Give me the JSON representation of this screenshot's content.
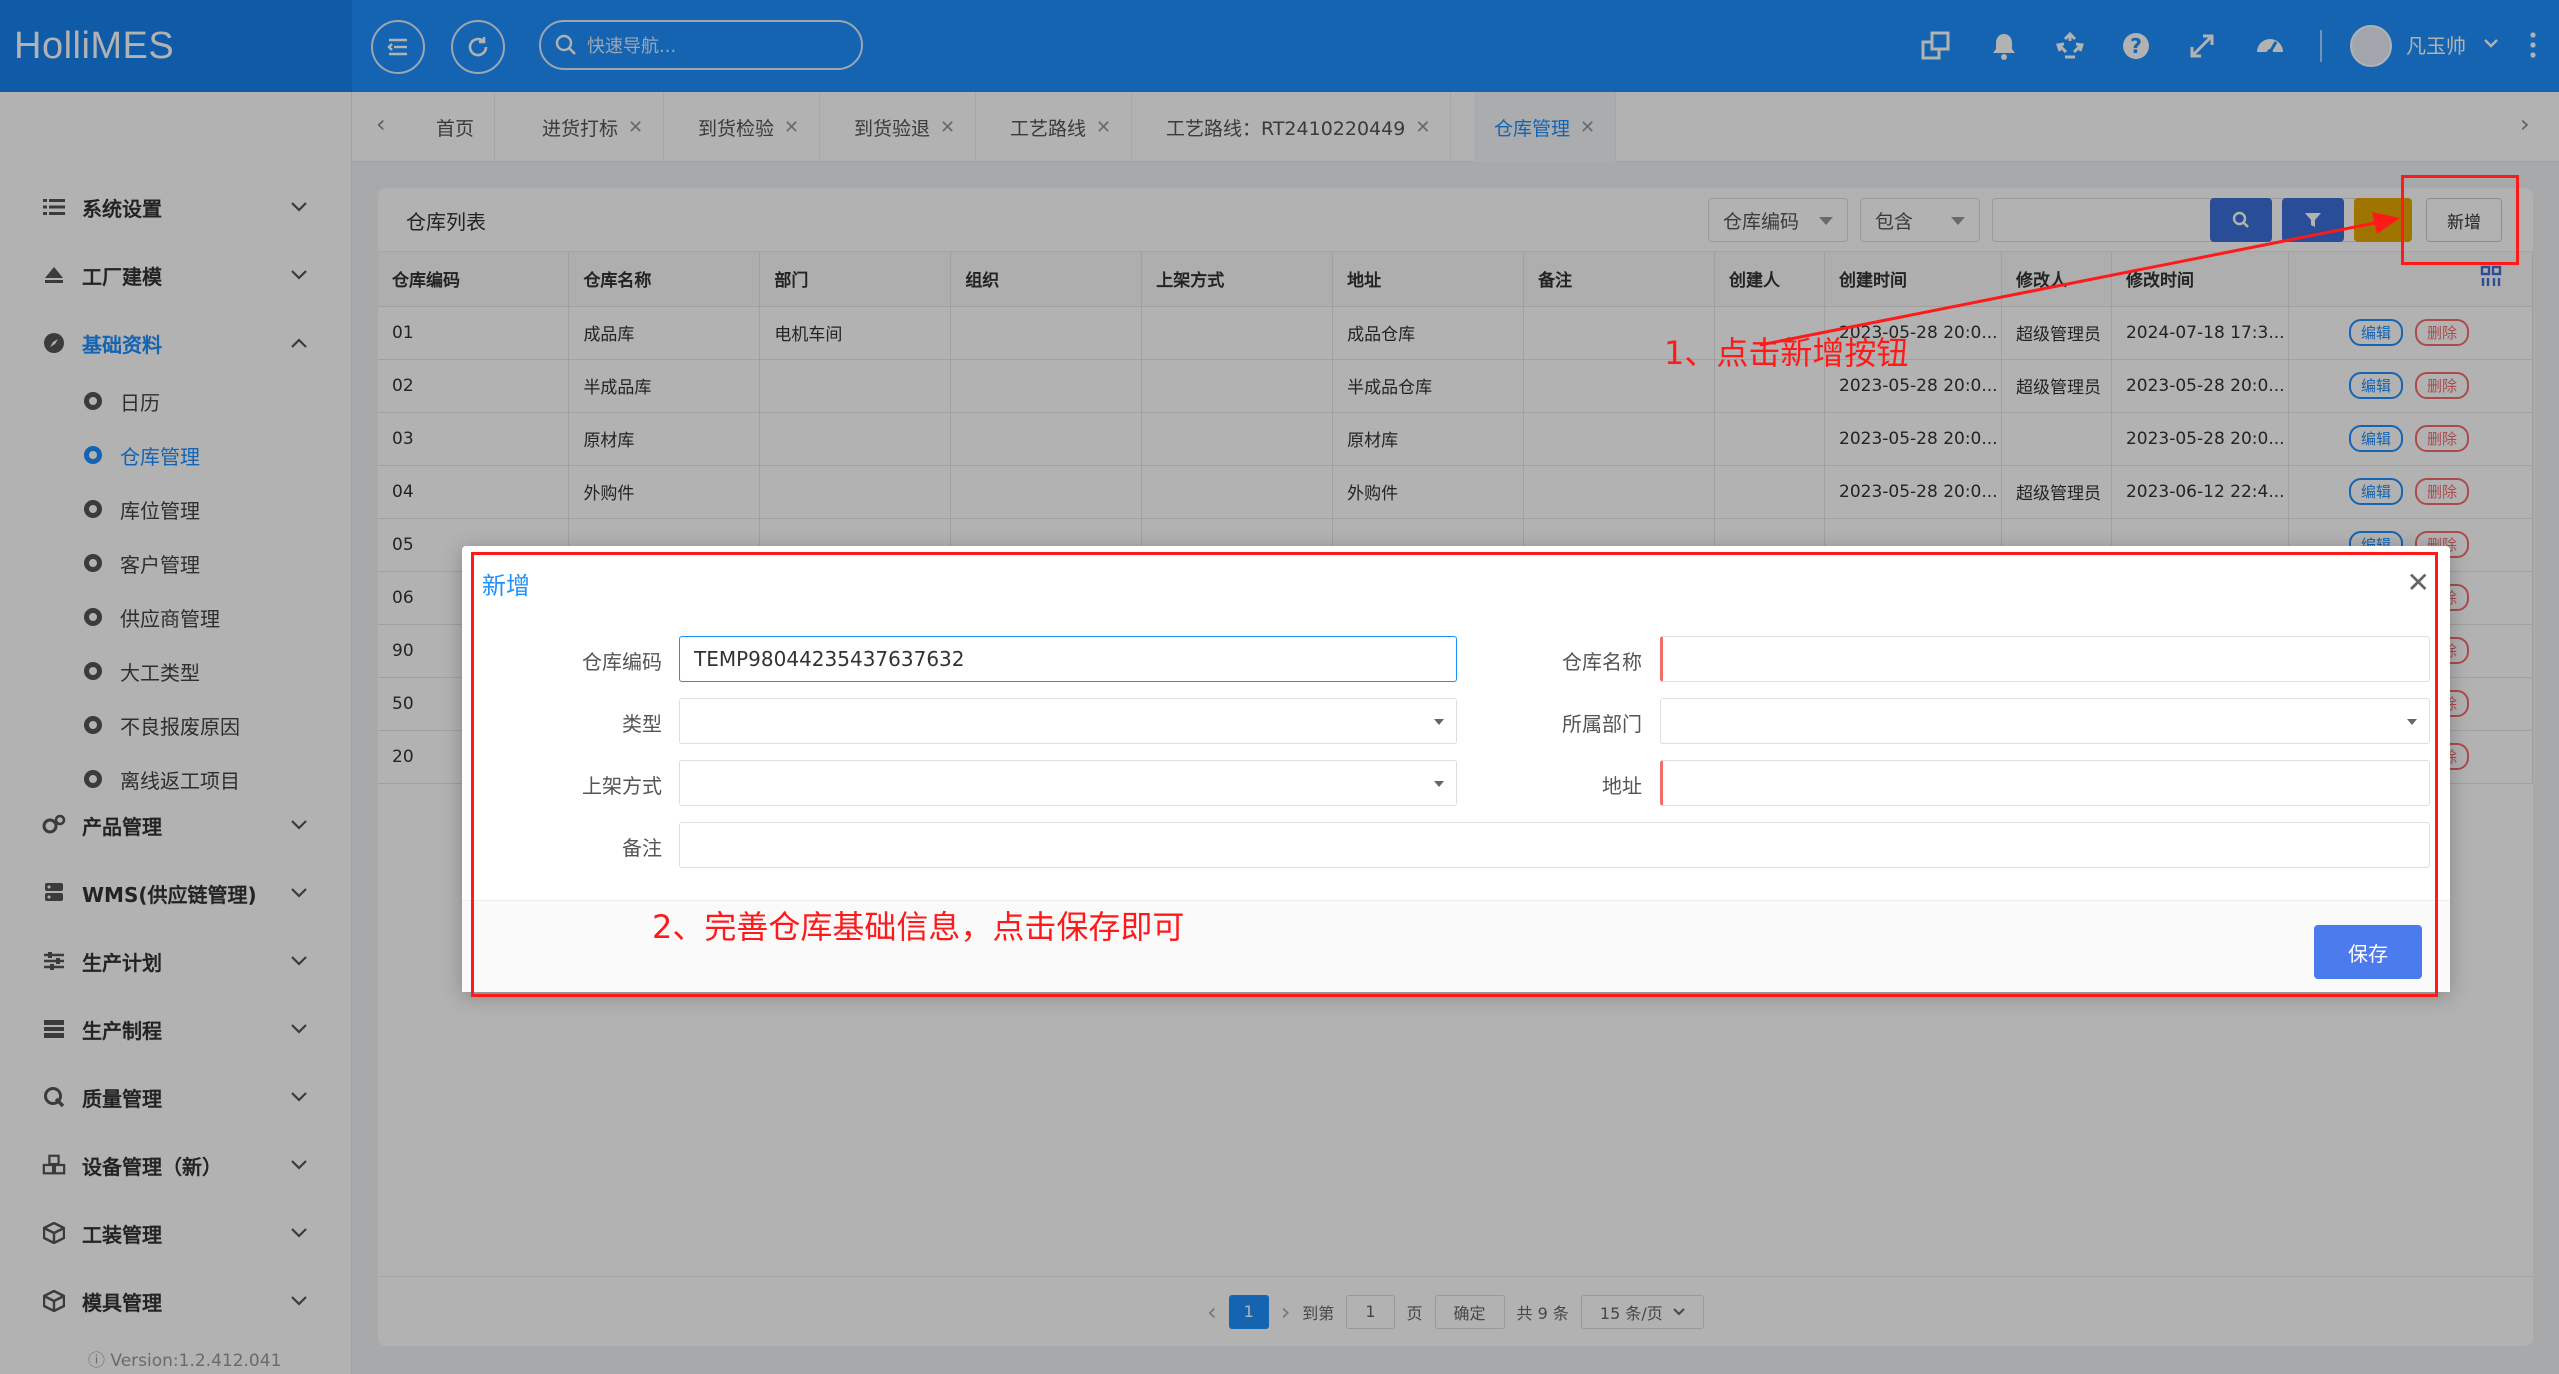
{
  "header": {
    "logo": "HolliMES",
    "search_placeholder": "快速导航...",
    "username": "凡玉帅"
  },
  "sidebar": {
    "menu": [
      {
        "label": "系统设置",
        "icon": "list-icon"
      },
      {
        "label": "工厂建模",
        "icon": "eject-icon"
      },
      {
        "label": "基础资料",
        "icon": "compass-icon"
      },
      {
        "label": "产品管理",
        "icon": "cogs-icon"
      },
      {
        "label": "WMS(供应链管理)",
        "icon": "server-icon"
      },
      {
        "label": "生产计划",
        "icon": "sliders-icon"
      },
      {
        "label": "生产制程",
        "icon": "stack-icon"
      },
      {
        "label": "质量管理",
        "icon": "q-icon"
      },
      {
        "label": "设备管理（新）",
        "icon": "cubes-icon"
      },
      {
        "label": "工装管理",
        "icon": "cube-icon"
      },
      {
        "label": "模具管理",
        "icon": "cube-icon"
      }
    ],
    "submenu": [
      "日历",
      "仓库管理",
      "库位管理",
      "客户管理",
      "供应商管理",
      "大工类型",
      "不良报废原因",
      "离线返工项目"
    ],
    "version": "ⓘ Version:1.2.412.041"
  },
  "tabs": [
    "首页",
    "进货打标",
    "到货检验",
    "到货验退",
    "工艺路线",
    "工艺路线：RT2410220449",
    "仓库管理"
  ],
  "panel": {
    "title": "仓库列表",
    "filter_field": "仓库编码",
    "filter_op": "包含",
    "add_label": "新增",
    "columns": [
      "仓库编码",
      "仓库名称",
      "部门",
      "组织",
      "上架方式",
      "地址",
      "备注",
      "创建人",
      "创建时间",
      "修改人",
      "修改时间"
    ],
    "rows": [
      [
        "01",
        "成品库",
        "电机车间",
        "",
        "",
        "成品仓库",
        "",
        "",
        "2023-05-28 20:0...",
        "超级管理员",
        "2024-07-18 17:3..."
      ],
      [
        "02",
        "半成品库",
        "",
        "",
        "",
        "半成品仓库",
        "",
        "",
        "2023-05-28 20:0...",
        "超级管理员",
        "2023-05-28 20:0..."
      ],
      [
        "03",
        "原材库",
        "",
        "",
        "",
        "原材库",
        "",
        "",
        "2023-05-28 20:0...",
        "",
        "2023-05-28 20:0..."
      ],
      [
        "04",
        "外购件",
        "",
        "",
        "",
        "外购件",
        "",
        "",
        "2023-05-28 20:0...",
        "超级管理员",
        "2023-06-12 22:4..."
      ],
      [
        "05",
        "",
        "",
        "",
        "",
        "",
        "",
        "",
        "",
        "",
        ""
      ],
      [
        "06",
        "",
        "",
        "",
        "",
        "",
        "",
        "",
        "",
        "",
        ""
      ],
      [
        "90",
        "",
        "",
        "",
        "",
        "",
        "",
        "",
        "",
        "",
        ""
      ],
      [
        "50",
        "",
        "",
        "",
        "",
        "",
        "",
        "",
        "",
        "",
        ""
      ],
      [
        "20",
        "",
        "",
        "",
        "",
        "",
        "",
        "",
        "",
        "",
        ""
      ]
    ],
    "edit_label": "编辑",
    "delete_label": "删除",
    "pager": {
      "current": "1",
      "goto": "到第",
      "page_input": "1",
      "page_unit": "页",
      "confirm": "确定",
      "total": "共 9 条",
      "page_size": "15 条/页"
    }
  },
  "dialog": {
    "title": "新增",
    "fields": {
      "code_label": "仓库编码",
      "code_value": "TEMP98044235437637632",
      "name_label": "仓库名称",
      "type_label": "类型",
      "dept_label": "所属部门",
      "shelf_label": "上架方式",
      "addr_label": "地址",
      "remark_label": "备注"
    },
    "save_label": "保存"
  },
  "annotations": {
    "step1": "1、点击新增按钮",
    "step2": "2、完善仓库基础信息，点击保存即可"
  },
  "colors": {
    "primary": "#1e90ff",
    "annotation": "#ff1a1a"
  }
}
